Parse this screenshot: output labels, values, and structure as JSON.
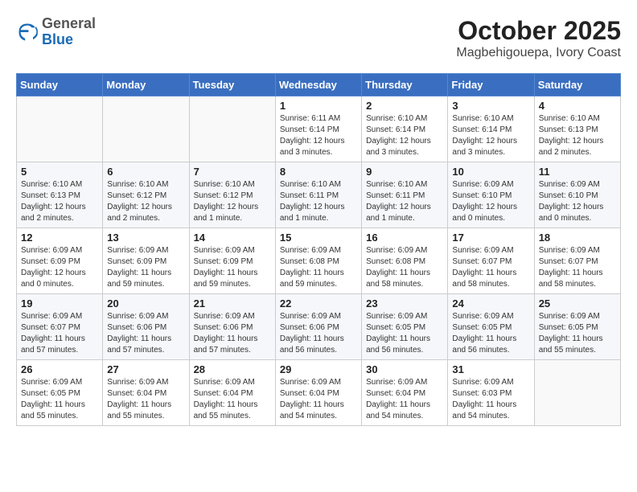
{
  "logo": {
    "general": "General",
    "blue": "Blue"
  },
  "header": {
    "month": "October 2025",
    "location": "Magbehigouepa, Ivory Coast"
  },
  "weekdays": [
    "Sunday",
    "Monday",
    "Tuesday",
    "Wednesday",
    "Thursday",
    "Friday",
    "Saturday"
  ],
  "weeks": [
    [
      {
        "day": "",
        "info": ""
      },
      {
        "day": "",
        "info": ""
      },
      {
        "day": "",
        "info": ""
      },
      {
        "day": "1",
        "info": "Sunrise: 6:11 AM\nSunset: 6:14 PM\nDaylight: 12 hours\nand 3 minutes."
      },
      {
        "day": "2",
        "info": "Sunrise: 6:10 AM\nSunset: 6:14 PM\nDaylight: 12 hours\nand 3 minutes."
      },
      {
        "day": "3",
        "info": "Sunrise: 6:10 AM\nSunset: 6:14 PM\nDaylight: 12 hours\nand 3 minutes."
      },
      {
        "day": "4",
        "info": "Sunrise: 6:10 AM\nSunset: 6:13 PM\nDaylight: 12 hours\nand 2 minutes."
      }
    ],
    [
      {
        "day": "5",
        "info": "Sunrise: 6:10 AM\nSunset: 6:13 PM\nDaylight: 12 hours\nand 2 minutes."
      },
      {
        "day": "6",
        "info": "Sunrise: 6:10 AM\nSunset: 6:12 PM\nDaylight: 12 hours\nand 2 minutes."
      },
      {
        "day": "7",
        "info": "Sunrise: 6:10 AM\nSunset: 6:12 PM\nDaylight: 12 hours\nand 1 minute."
      },
      {
        "day": "8",
        "info": "Sunrise: 6:10 AM\nSunset: 6:11 PM\nDaylight: 12 hours\nand 1 minute."
      },
      {
        "day": "9",
        "info": "Sunrise: 6:10 AM\nSunset: 6:11 PM\nDaylight: 12 hours\nand 1 minute."
      },
      {
        "day": "10",
        "info": "Sunrise: 6:09 AM\nSunset: 6:10 PM\nDaylight: 12 hours\nand 0 minutes."
      },
      {
        "day": "11",
        "info": "Sunrise: 6:09 AM\nSunset: 6:10 PM\nDaylight: 12 hours\nand 0 minutes."
      }
    ],
    [
      {
        "day": "12",
        "info": "Sunrise: 6:09 AM\nSunset: 6:09 PM\nDaylight: 12 hours\nand 0 minutes."
      },
      {
        "day": "13",
        "info": "Sunrise: 6:09 AM\nSunset: 6:09 PM\nDaylight: 11 hours\nand 59 minutes."
      },
      {
        "day": "14",
        "info": "Sunrise: 6:09 AM\nSunset: 6:09 PM\nDaylight: 11 hours\nand 59 minutes."
      },
      {
        "day": "15",
        "info": "Sunrise: 6:09 AM\nSunset: 6:08 PM\nDaylight: 11 hours\nand 59 minutes."
      },
      {
        "day": "16",
        "info": "Sunrise: 6:09 AM\nSunset: 6:08 PM\nDaylight: 11 hours\nand 58 minutes."
      },
      {
        "day": "17",
        "info": "Sunrise: 6:09 AM\nSunset: 6:07 PM\nDaylight: 11 hours\nand 58 minutes."
      },
      {
        "day": "18",
        "info": "Sunrise: 6:09 AM\nSunset: 6:07 PM\nDaylight: 11 hours\nand 58 minutes."
      }
    ],
    [
      {
        "day": "19",
        "info": "Sunrise: 6:09 AM\nSunset: 6:07 PM\nDaylight: 11 hours\nand 57 minutes."
      },
      {
        "day": "20",
        "info": "Sunrise: 6:09 AM\nSunset: 6:06 PM\nDaylight: 11 hours\nand 57 minutes."
      },
      {
        "day": "21",
        "info": "Sunrise: 6:09 AM\nSunset: 6:06 PM\nDaylight: 11 hours\nand 57 minutes."
      },
      {
        "day": "22",
        "info": "Sunrise: 6:09 AM\nSunset: 6:06 PM\nDaylight: 11 hours\nand 56 minutes."
      },
      {
        "day": "23",
        "info": "Sunrise: 6:09 AM\nSunset: 6:05 PM\nDaylight: 11 hours\nand 56 minutes."
      },
      {
        "day": "24",
        "info": "Sunrise: 6:09 AM\nSunset: 6:05 PM\nDaylight: 11 hours\nand 56 minutes."
      },
      {
        "day": "25",
        "info": "Sunrise: 6:09 AM\nSunset: 6:05 PM\nDaylight: 11 hours\nand 55 minutes."
      }
    ],
    [
      {
        "day": "26",
        "info": "Sunrise: 6:09 AM\nSunset: 6:05 PM\nDaylight: 11 hours\nand 55 minutes."
      },
      {
        "day": "27",
        "info": "Sunrise: 6:09 AM\nSunset: 6:04 PM\nDaylight: 11 hours\nand 55 minutes."
      },
      {
        "day": "28",
        "info": "Sunrise: 6:09 AM\nSunset: 6:04 PM\nDaylight: 11 hours\nand 55 minutes."
      },
      {
        "day": "29",
        "info": "Sunrise: 6:09 AM\nSunset: 6:04 PM\nDaylight: 11 hours\nand 54 minutes."
      },
      {
        "day": "30",
        "info": "Sunrise: 6:09 AM\nSunset: 6:04 PM\nDaylight: 11 hours\nand 54 minutes."
      },
      {
        "day": "31",
        "info": "Sunrise: 6:09 AM\nSunset: 6:03 PM\nDaylight: 11 hours\nand 54 minutes."
      },
      {
        "day": "",
        "info": ""
      }
    ]
  ]
}
